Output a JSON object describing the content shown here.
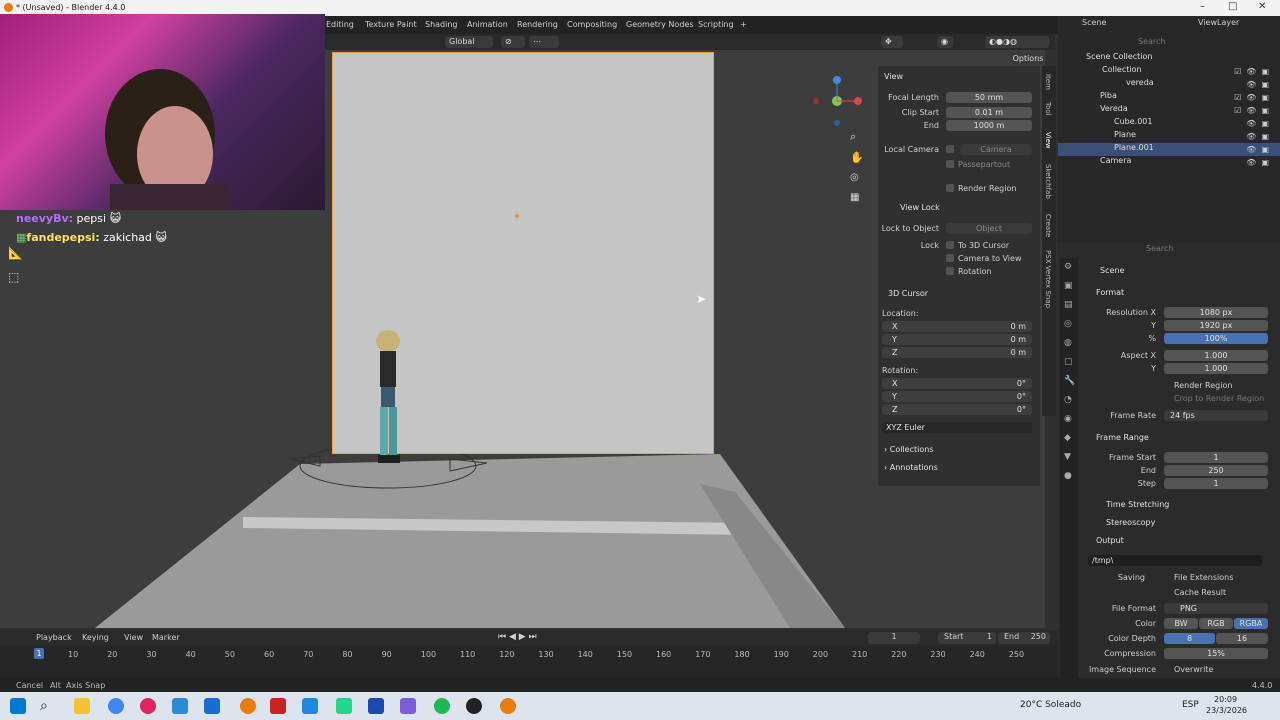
{
  "window": {
    "title": "* (Unsaved) - Blender 4.4.0"
  },
  "workspaces": [
    "Editing",
    "Texture Paint",
    "Shading",
    "Animation",
    "Rendering",
    "Compositing",
    "Geometry Nodes",
    "Scripting",
    "+"
  ],
  "viewport_header": {
    "orientation": "Global",
    "options": "Options"
  },
  "chat": [
    {
      "user": "neevyBv:",
      "message": "pepsi"
    },
    {
      "user": "fandepepsi:",
      "message": "zakichad"
    }
  ],
  "npanel": {
    "view_header": "View",
    "focal_length_label": "Focal Length",
    "focal_length": "50 mm",
    "clip_start_label": "Clip Start",
    "clip_start": "0.01 m",
    "end_label": "End",
    "end": "1000 m",
    "local_camera_label": "Local Camera",
    "local_camera": "Camera",
    "passepartout": "Passepartout",
    "render_region": "Render Region",
    "view_lock_header": "View Lock",
    "lock_to_object_label": "Lock to Object",
    "lock_to_object": "Object",
    "lock_label": "Lock",
    "to_3d_cursor": "To 3D Cursor",
    "camera_to_view": "Camera to View",
    "rotation_lock": "Rotation",
    "cursor_header": "3D Cursor",
    "location_label": "Location:",
    "loc_x": "0 m",
    "loc_y": "0 m",
    "loc_z": "0 m",
    "rotation_label": "Rotation:",
    "rot_x": "0°",
    "rot_y": "0°",
    "rot_z": "0°",
    "rotation_mode": "XYZ Euler",
    "collections": "Collections",
    "annotations": "Annotations",
    "x": "X",
    "y": "Y",
    "z": "Z"
  },
  "vtabs": [
    "Item",
    "Tool",
    "View",
    "Sketchfab",
    "Create",
    "PSX Vertex Snap"
  ],
  "outliner": {
    "scene_label": "Scene",
    "view_layer": "ViewLayer",
    "search": "Search",
    "rows": [
      {
        "label": "Scene Collection"
      },
      {
        "label": "Collection"
      },
      {
        "label": "vereda"
      },
      {
        "label": "Piba"
      },
      {
        "label": "Vereda"
      },
      {
        "label": "Cube.001"
      },
      {
        "label": "Plane"
      },
      {
        "label": "Plane.001"
      },
      {
        "label": "Camera"
      }
    ]
  },
  "properties": {
    "search": "Search",
    "scene": "Scene",
    "format": "Format",
    "res_x_label": "Resolution X",
    "res_x": "1080 px",
    "res_y_label": "Y",
    "res_y": "1920 px",
    "pct_label": "%",
    "pct": "100%",
    "aspect_x_label": "Aspect X",
    "aspect_x": "1.000",
    "aspect_y_label": "Y",
    "aspect_y": "1.000",
    "render_region": "Render Region",
    "crop": "Crop to Render Region",
    "frame_rate_label": "Frame Rate",
    "frame_rate": "24 fps",
    "frame_range": "Frame Range",
    "frame_start_label": "Frame Start",
    "frame_start": "1",
    "end_label": "End",
    "end": "250",
    "step_label": "Step",
    "step": "1",
    "time_stretching": "Time Stretching",
    "stereoscopy": "Stereoscopy",
    "output": "Output",
    "path": "/tmp\\",
    "saving_label": "Saving",
    "file_extensions": "File Extensions",
    "cache_result": "Cache Result",
    "file_format_label": "File Format",
    "file_format": "PNG",
    "color_label": "Color",
    "bw": "BW",
    "rgb": "RGB",
    "rgba": "RGBA",
    "color_depth_label": "Color Depth",
    "depth8": "8",
    "depth16": "16",
    "compression_label": "Compression",
    "compression": "15%",
    "image_sequence_label": "Image Sequence",
    "overwrite": "Overwrite"
  },
  "timeline": {
    "playback": "Playback",
    "keying": "Keying",
    "view": "View",
    "marker": "Marker",
    "current_frame": "1",
    "start_label": "Start",
    "start": "1",
    "end_label": "End",
    "end": "250",
    "ticks": [
      "10",
      "20",
      "30",
      "40",
      "50",
      "60",
      "70",
      "80",
      "90",
      "100",
      "110",
      "120",
      "130",
      "140",
      "150",
      "160",
      "170",
      "180",
      "190",
      "200",
      "210",
      "220",
      "230",
      "240",
      "250"
    ],
    "playhead": "1"
  },
  "status": {
    "cancel": "Cancel",
    "alt": "Alt",
    "axis_snap": "Axis Snap",
    "version": "4.4.0"
  },
  "taskbar": {
    "weather": "20°C Soleado",
    "lang": "ESP",
    "time": "20:09",
    "date": "23/3/2026"
  }
}
